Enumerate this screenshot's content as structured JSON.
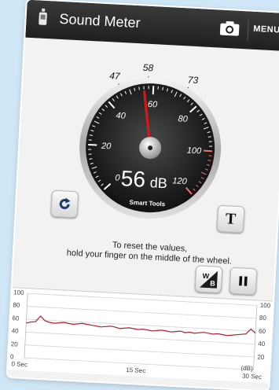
{
  "header": {
    "title": "Sound Meter",
    "menu_label": "MENU"
  },
  "gauge": {
    "min_label": "47",
    "avg_label": "58",
    "max_label": "73",
    "current_value": "56",
    "unit": "dB",
    "brand": "Smart Tools",
    "ticks": [
      "0",
      "20",
      "40",
      "60",
      "80",
      "100",
      "120"
    ],
    "needle_db": 56
  },
  "instructions": {
    "line1": "To reset the values,",
    "line2": "hold your finger on the middle of the wheel."
  },
  "graph": {
    "y_left": [
      "100",
      "80",
      "60",
      "40",
      "20",
      "0"
    ],
    "y_right": [
      "100",
      "80",
      "60",
      "40",
      "20"
    ],
    "x_labels": [
      "0 Sec",
      "15 Sec",
      "30 Sec"
    ],
    "unit": "(dB)",
    "values": [
      54,
      56,
      57,
      66,
      59,
      57,
      56,
      57,
      58,
      57,
      56,
      57,
      58,
      57,
      56,
      55,
      54,
      55,
      56,
      55,
      53,
      54,
      55,
      54,
      53,
      54,
      53,
      52,
      53,
      54,
      53,
      52,
      53,
      54,
      52,
      53,
      52,
      53,
      54,
      53,
      52,
      53,
      52,
      51,
      52,
      53,
      54,
      55,
      63,
      57
    ]
  }
}
